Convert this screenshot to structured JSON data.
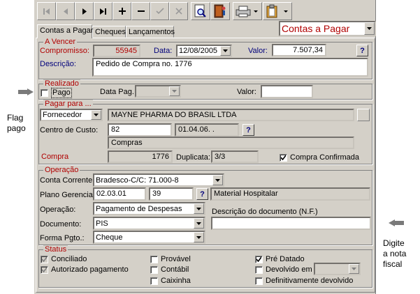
{
  "annotations": {
    "left_label_line1": "Flag",
    "left_label_line2": "pago",
    "right_label_line1": "Digite",
    "right_label_line2": "a nota",
    "right_label_line3": "fiscal"
  },
  "toolbar": {
    "buttons": [
      "first-record",
      "prev-record",
      "next-record",
      "last-record",
      "add",
      "delete",
      "confirm",
      "cancel",
      "search",
      "exit",
      "print",
      "clipboard"
    ]
  },
  "tabs": [
    "Contas a Pagar",
    "Cheques",
    "Lançamentos"
  ],
  "mode_select": {
    "value": "Contas a Pagar"
  },
  "a_vencer": {
    "title": "A Vencer",
    "compromisso_label": "Compromisso:",
    "compromisso_value": "55945",
    "data_label": "Data:",
    "data_value": "12/08/2005",
    "valor_label": "Valor:",
    "valor_value": "7.507,34",
    "descricao_label": "Descrição:",
    "descricao_value": "Pedido de Compra no. 1776"
  },
  "realizado": {
    "title": "Realizado",
    "pago_label": "Pago",
    "pago_checked": false,
    "data_pag_label": "Data Pag.",
    "data_pag_value": "",
    "valor_label": "Valor:",
    "valor_value": ""
  },
  "pagar_para": {
    "title": "Pagar para ...",
    "tipo_value": "Fornecedor",
    "nome_value": "MAYNE PHARMA DO BRASIL LTDA",
    "centro_custo_label": "Centro de Custo:",
    "centro_custo_value": "82",
    "centro_custo_code": "01.04.06. .",
    "centro_custo_desc": "Compras",
    "compra_label": "Compra",
    "compra_value": "1776",
    "duplicata_label": "Duplicata:",
    "duplicata_value": "3/3",
    "compra_confirmada_label": "Compra Confirmada",
    "compra_confirmada_checked": true
  },
  "operacao": {
    "title": "Operação",
    "conta_corrente_label": "Conta Corrente:",
    "conta_corrente_value": "Bradesco-C/C: 71.000-8",
    "plano_label": "Plano Gerencial:",
    "plano_value": "02.03.01",
    "plano_num": "39",
    "plano_desc": "Material Hospitalar",
    "operacao_label": "Operação:",
    "operacao_value": "Pagamento de Despesas",
    "documento_label": "Documento:",
    "documento_value": "PIS",
    "forma_label": "Forma Pgto.:",
    "forma_value": "Cheque",
    "descricao_doc_label": "Descrição do documento (N.F.)",
    "descricao_doc_value": ""
  },
  "status": {
    "title": "Status",
    "conciliado_label": "Conciliado",
    "conciliado_checked": true,
    "autorizado_label": "Autorizado pagamento",
    "autorizado_checked": true,
    "provavel_label": "Provável",
    "provavel_checked": false,
    "contabil_label": "Contábil",
    "contabil_checked": false,
    "caixinha_label": "Caixinha",
    "caixinha_checked": false,
    "pre_datado_label": "Pré Datado",
    "pre_datado_checked": true,
    "devolvido_label": "Devolvido em",
    "devolvido_checked": false,
    "devolvido_value": "",
    "definitivamente_label": "Definitivamente devolvido",
    "definitivamente_checked": false
  },
  "colors": {
    "window_bg": "#d4d0c8",
    "group_title": "#b00000",
    "field_label": "#00007b"
  }
}
